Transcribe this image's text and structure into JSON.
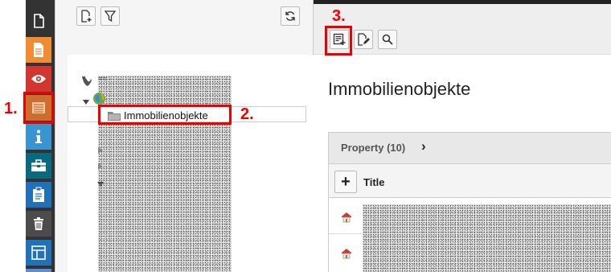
{
  "tree": {
    "node_label": "Immobilienobjekte",
    "root_label": "≈≈"
  },
  "content": {
    "heading": "Immobilienobjekte",
    "panel_title": "Property (10)",
    "panel_chevron": "›",
    "column_title": "Title",
    "expand_symbol": "+"
  },
  "annotations": {
    "step1": "1.",
    "step2": "2.",
    "step3": "3."
  },
  "modules": [
    {
      "name": "page-module",
      "icon": "page-icon",
      "color": "#333333"
    },
    {
      "name": "pagelayout-module",
      "icon": "document-icon",
      "color": "#f28c33"
    },
    {
      "name": "view-module",
      "icon": "eye-icon",
      "color": "#d2372f"
    },
    {
      "name": "list-module",
      "icon": "list-icon",
      "color": "#ce6d30"
    },
    {
      "name": "info-module",
      "icon": "info-icon",
      "color": "#3a94d0"
    },
    {
      "name": "access-module",
      "icon": "toolbox-icon",
      "color": "#086a7e"
    },
    {
      "name": "reports-module",
      "icon": "clipboard-icon",
      "color": "#1f72b9"
    },
    {
      "name": "recycler-module",
      "icon": "trash-icon",
      "color": "#4c4c4c"
    },
    {
      "name": "template-module",
      "icon": "layout-icon",
      "color": "#1f72b9"
    }
  ]
}
